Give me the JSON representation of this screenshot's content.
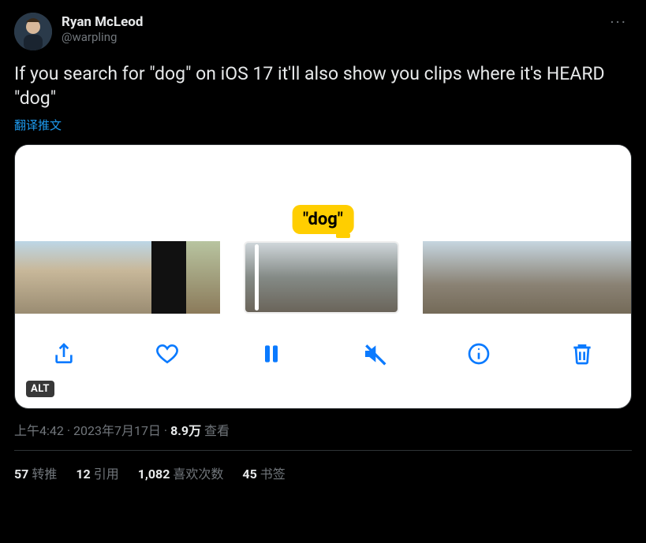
{
  "author": {
    "display_name": "Ryan McLeod",
    "handle": "@warpling"
  },
  "tweet_text": "If you search for \"dog\" on iOS 17 it'll also show you clips where it's HEARD \"dog\"",
  "translate_label": "翻译推文",
  "media": {
    "search_token": "\"dog\"",
    "alt_badge": "ALT",
    "toolbar_icons": {
      "share": "share-icon",
      "heart": "heart-icon",
      "pause": "pause-icon",
      "mute": "mute-icon",
      "info": "info-icon",
      "trash": "trash-icon"
    }
  },
  "meta": {
    "time": "上午4:42",
    "date": "2023年7月17日",
    "separator": " · ",
    "views_count": "8.9万",
    "views_label": " 查看"
  },
  "stats": {
    "retweets": {
      "count": "57",
      "label": "转推"
    },
    "quotes": {
      "count": "12",
      "label": "引用"
    },
    "likes": {
      "count": "1,082",
      "label": "喜欢次数"
    },
    "bookmarks": {
      "count": "45",
      "label": "书签"
    }
  }
}
